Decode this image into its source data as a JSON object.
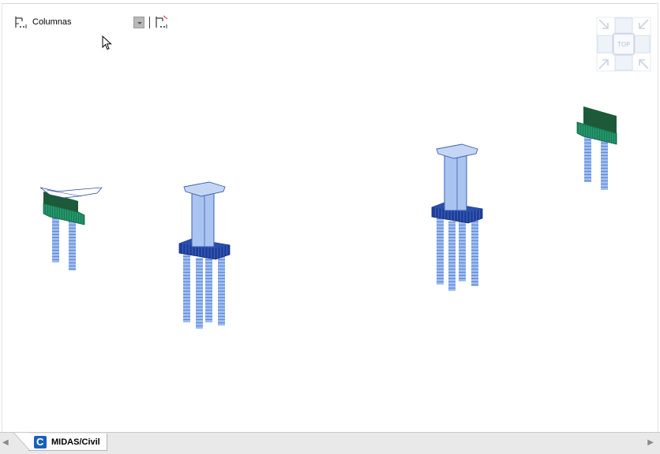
{
  "toolbar": {
    "group_label": "Columnas",
    "group_icon": "tree-filter-icon",
    "dropdown_icon": "chevron-down-icon",
    "second_icon": "tree-filter-options-icon"
  },
  "viewcube": {
    "face_label": "TOP"
  },
  "document_tabs": [
    {
      "label": "MIDAS/Civil",
      "icon": "midas-civil-icon",
      "active": true
    }
  ],
  "colors": {
    "column_fill": "#a9c4f0",
    "column_edge": "#3d5fb0",
    "pile_fill": "#8fb0e8",
    "pile_cap": "#243f9a",
    "abutment_green": "#1f8a5a",
    "abutment_dark": "#1d5a3a"
  }
}
